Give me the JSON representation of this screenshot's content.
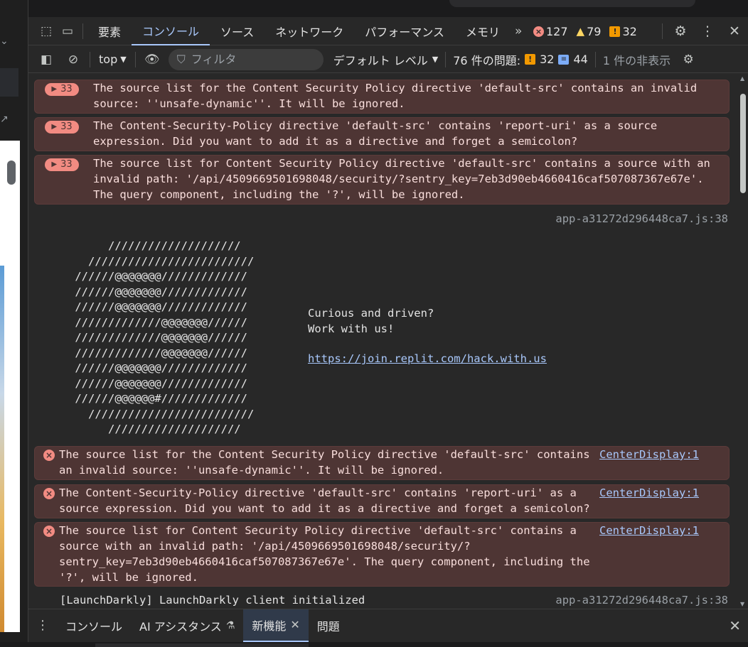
{
  "tabbar": {
    "tabs": [
      "要素",
      "コンソール",
      "ソース",
      "ネットワーク",
      "パフォーマンス",
      "メモリ"
    ],
    "active_tab": "コンソール",
    "error_count": "127",
    "warning_count": "79",
    "issue_count": "32"
  },
  "toolbar": {
    "context": "top",
    "filter_placeholder": "フィルタ",
    "levels": "デフォルト レベル",
    "issues_label": "76 件の問題:",
    "issues_errors": "32",
    "issues_info": "44",
    "hidden": "1 件の非表示"
  },
  "console": {
    "grouped": [
      {
        "count": "33",
        "text": "The source list for the Content Security Policy directive 'default-src' contains an invalid source: ''unsafe-dynamic''. It will be ignored."
      },
      {
        "count": "33",
        "text": "The Content-Security-Policy directive 'default-src' contains 'report-uri' as a source expression. Did you want to add it as a directive and forget a semicolon?"
      },
      {
        "count": "33",
        "text": "The source list for Content Security Policy directive 'default-src' contains a source with an invalid path: '/api/4509669501698048/security/?sentry_key=7eb3d90eb4660416caf507087367e67e'. The query component, including the '?', will be ignored."
      }
    ],
    "banner_source": "app-a31272d296448ca7.js:38",
    "ascii_art": "      ////////////////////\n   /////////////////////////\n //////@@@@@@@/////////////\n //////@@@@@@@/////////////\n //////@@@@@@@/////////////\n /////////////@@@@@@@//////\n /////////////@@@@@@@//////\n /////////////@@@@@@@//////\n //////@@@@@@@/////////////\n //////@@@@@@@/////////////\n //////@@@@@@#/////////////\n   /////////////////////////\n      ////////////////////",
    "banner_line1": "Curious and driven?",
    "banner_line2": "Work with us!",
    "banner_link": "https://join.replit.com/hack.with.us",
    "errors": [
      {
        "text": "The source list for the Content Security Policy directive 'default-src' contains an invalid source: ''unsafe-dynamic''. It will be ignored.",
        "source": "CenterDisplay:1"
      },
      {
        "text": "The Content-Security-Policy directive 'default-src' contains 'report-uri' as a source expression. Did you want to add it as a directive and forget a semicolon?",
        "source": "CenterDisplay:1"
      },
      {
        "text": "The source list for Content Security Policy directive 'default-src' contains a source with an invalid path: '/api/4509669501698048/security/?sentry_key=7eb3d90eb4660416caf507087367e67e'. The query component, including the '?', will be ignored.",
        "source": "CenterDisplay:1"
      }
    ],
    "last_line": "[LaunchDarkly] LaunchDarkly client initialized",
    "last_source": "app-a31272d296448ca7.js:38"
  },
  "drawer": {
    "tabs": [
      "コンソール",
      "AI アシスタンス",
      "新機能",
      "問題"
    ],
    "active_tab": "新機能"
  },
  "colors": {
    "accent": "#a8c7fa",
    "error_bg": "#4e3534",
    "error_icon": "#f28b82",
    "warning": "#fdd663"
  }
}
